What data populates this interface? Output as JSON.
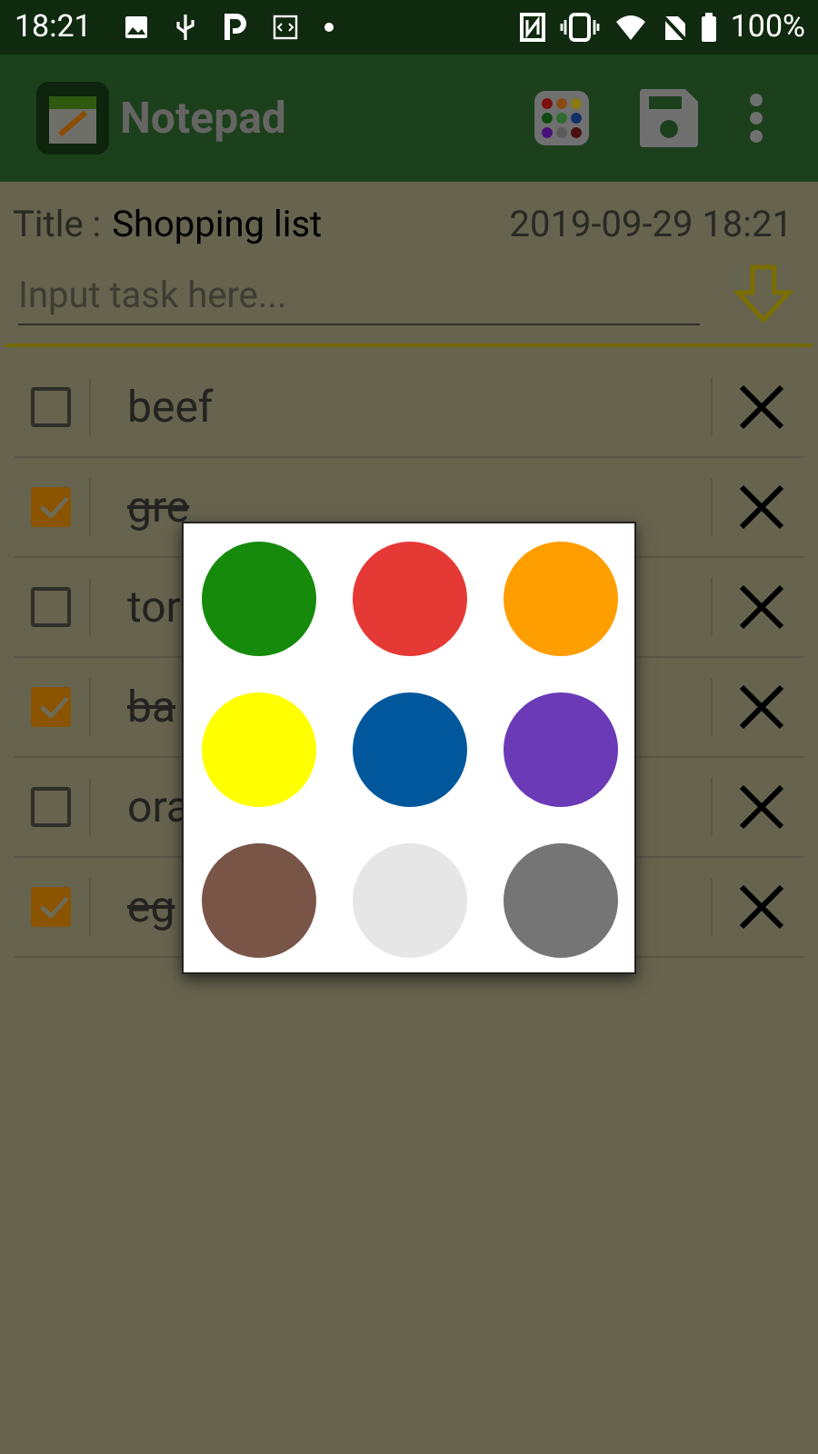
{
  "status_bar": {
    "time": "18:21",
    "battery": "100%"
  },
  "app_bar": {
    "title": "Notepad"
  },
  "note": {
    "title_label": "Title :",
    "title": "Shopping list",
    "date": "2019-09-29 18:21"
  },
  "task_input": {
    "placeholder": "Input task here..."
  },
  "tasks": [
    {
      "text": "beef",
      "checked": false
    },
    {
      "text": "gre",
      "checked": true
    },
    {
      "text": "tor",
      "checked": false
    },
    {
      "text": "ba",
      "checked": true
    },
    {
      "text": "ora",
      "checked": false
    },
    {
      "text": "eg",
      "checked": true
    }
  ],
  "color_picker": {
    "colors": [
      {
        "color": "#168a0a"
      },
      {
        "color": "#e53935"
      },
      {
        "color": "#ff9e00"
      },
      {
        "color": "#ffff00"
      },
      {
        "color": "#01579b"
      },
      {
        "color": "#6a3ab7"
      },
      {
        "color": "#795548"
      },
      {
        "color": "#e6e6e6"
      },
      {
        "color": "#757575"
      }
    ]
  }
}
